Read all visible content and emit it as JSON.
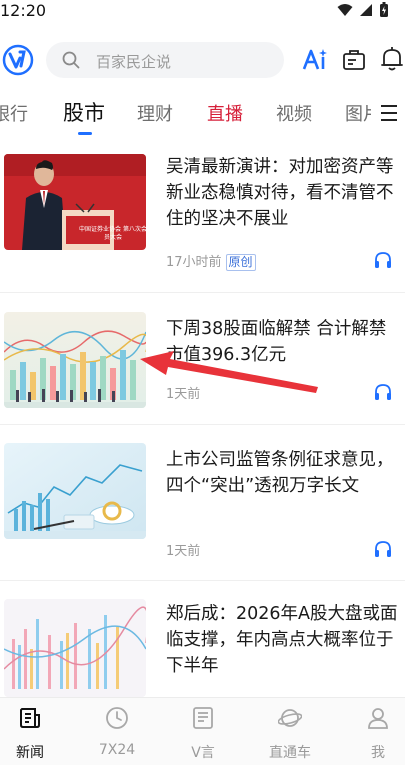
{
  "status": {
    "time": "12:20"
  },
  "search": {
    "placeholder": "百家民企说"
  },
  "tabs": [
    {
      "label": "银行"
    },
    {
      "label": "股市"
    },
    {
      "label": "理财"
    },
    {
      "label": "直播"
    },
    {
      "label": "视频"
    },
    {
      "label": "图片"
    }
  ],
  "articles": [
    {
      "title": "吴清最新演讲：对加密资产等新业态稳慎对待，看不清管不住的坚决不展业",
      "time": "17小时前",
      "tag": "原创",
      "image_banner": "中国证券业协会 第八次会员大会"
    },
    {
      "title": "下周38股面临解禁 合计解禁市值396.3亿元",
      "time": "1天前"
    },
    {
      "title": "上市公司监管条例征求意见，四个“突出”透视万字长文",
      "time": "1天前"
    },
    {
      "title": "郑后成：2026年A股大盘或面临支撑，年内高点大概率位于下半年",
      "time": ""
    }
  ],
  "bottom_nav": [
    {
      "label": "新闻",
      "icon": "news-icon"
    },
    {
      "label": "7X24",
      "icon": "clock-icon"
    },
    {
      "label": "V言",
      "icon": "doc-icon"
    },
    {
      "label": "直通车",
      "icon": "planet-icon"
    },
    {
      "label": "我",
      "icon": "user-icon"
    }
  ],
  "colors": {
    "accent": "#1f6fff",
    "live": "#d6203a",
    "annotation": "#e8333a"
  }
}
